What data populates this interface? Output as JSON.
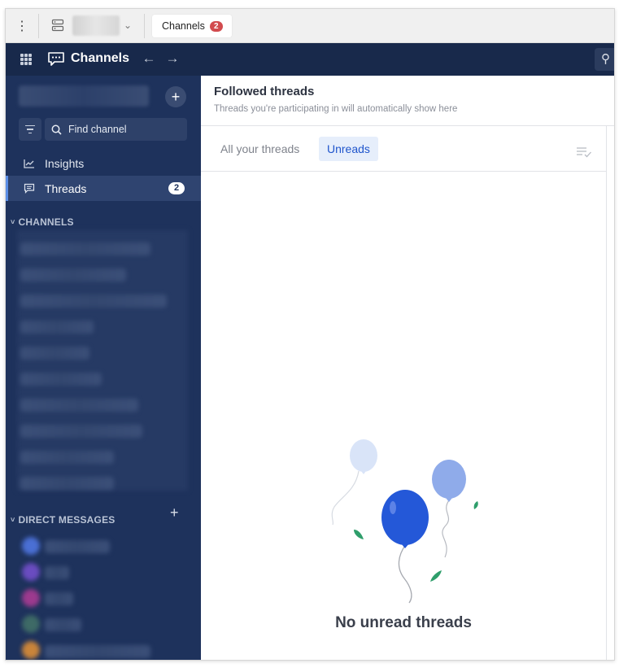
{
  "tabbar": {
    "tab_label": "Channels",
    "tab_badge": "2"
  },
  "header": {
    "title": "Channels"
  },
  "sidebar": {
    "find_channel_placeholder": "Find channel",
    "items": [
      {
        "label": "Insights",
        "icon": "chart-line-icon"
      },
      {
        "label": "Threads",
        "icon": "message-text-icon",
        "count": "2"
      }
    ],
    "channels_header": "CHANNELS",
    "dm_header": "DIRECT MESSAGES"
  },
  "main": {
    "title": "Followed threads",
    "subtitle": "Threads you're participating in will automatically show here",
    "tabs": [
      "All your threads",
      "Unreads"
    ],
    "empty_title": "No unread threads"
  },
  "colors": {
    "header_bg": "#18294b",
    "sidebar_bg": "#1e325c",
    "accent": "#1f55cc",
    "badge": "#d24b4e"
  }
}
